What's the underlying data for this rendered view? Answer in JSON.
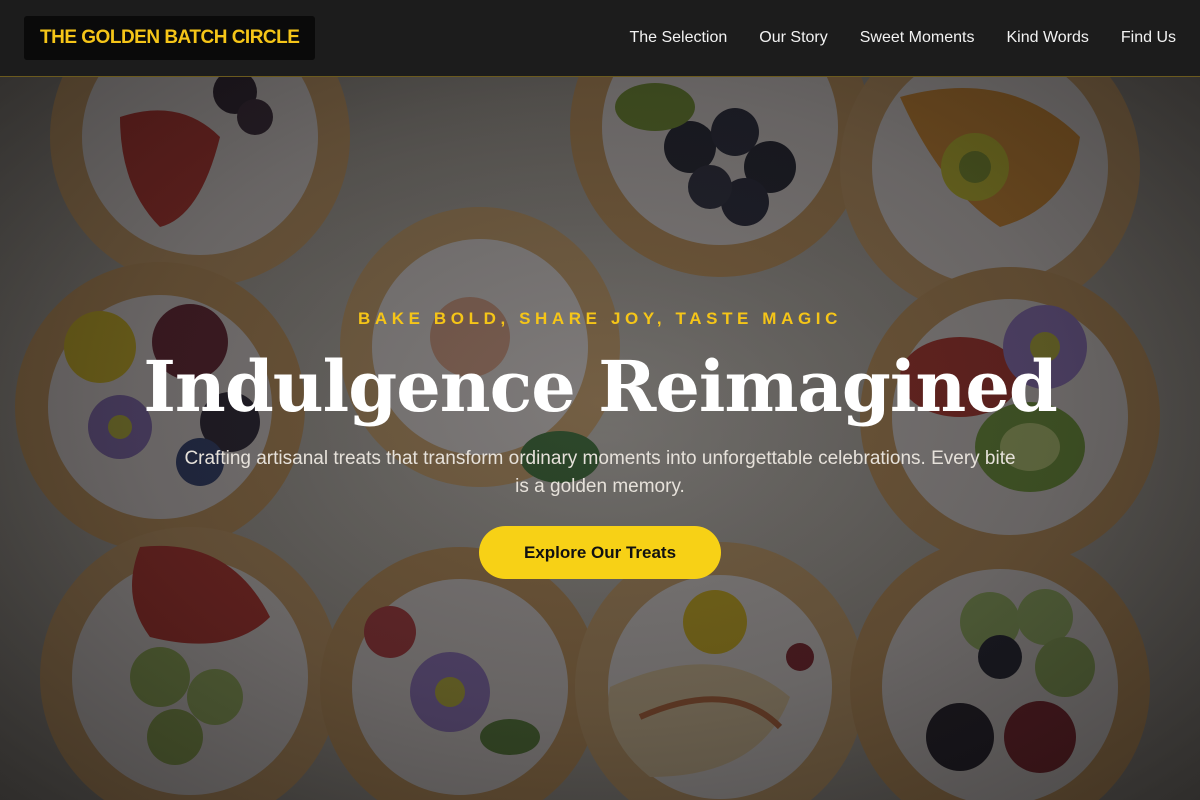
{
  "header": {
    "brand": "THE GOLDEN BATCH CIRCLE",
    "nav": [
      {
        "label": "The Selection"
      },
      {
        "label": "Our Story"
      },
      {
        "label": "Sweet Moments"
      },
      {
        "label": "Kind Words"
      },
      {
        "label": "Find Us"
      }
    ]
  },
  "hero": {
    "tagline": "BAKE BOLD, SHARE JOY, TASTE MAGIC",
    "headline": "Indulgence Reimagined",
    "subtitle": "Crafting artisanal treats that transform ordinary moments into unforgettable celebrations. Every bite is a golden memory.",
    "cta_label": "Explore Our Treats"
  },
  "colors": {
    "accent": "#f5c518",
    "button": "#f7d116",
    "header_bg": "#1c1c1c"
  }
}
